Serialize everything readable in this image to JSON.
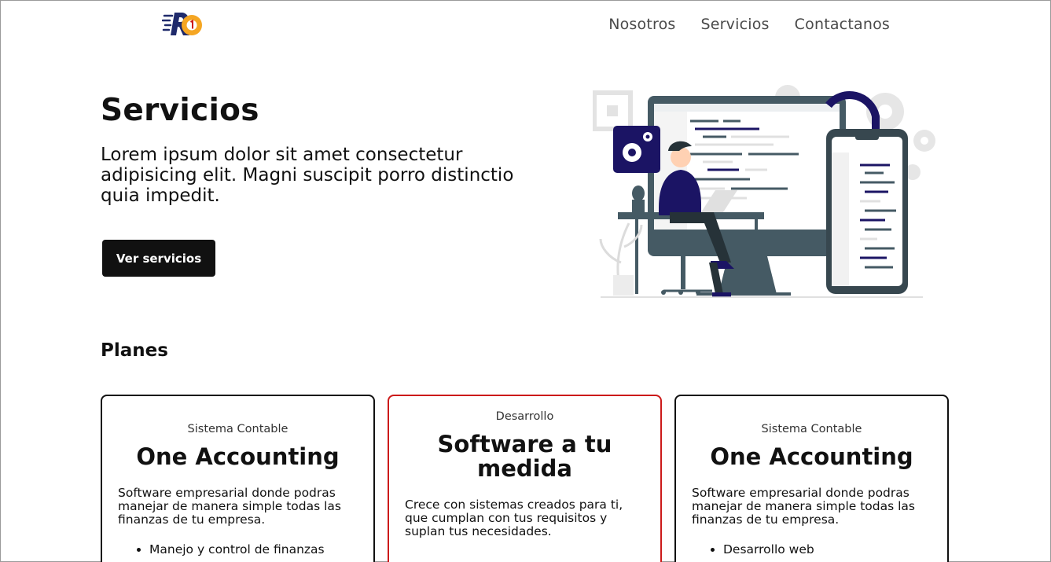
{
  "nav": {
    "items": [
      {
        "label": "Nosotros"
      },
      {
        "label": "Servicios"
      },
      {
        "label": "Contactanos"
      }
    ]
  },
  "hero": {
    "title": "Servicios",
    "text": "Lorem ipsum dolor sit amet consectetur adipisicing elit. Magni suscipit porro distinctio quia impedit.",
    "button_label": "Ver servicios"
  },
  "plans": {
    "title": "Planes",
    "cards": [
      {
        "category": "Sistema Contable",
        "title": "One Accounting",
        "description": "Software empresarial donde podras manejar de manera simple todas las finanzas de tu empresa.",
        "features": [
          "Manejo y control de finanzas"
        ]
      },
      {
        "category": "Desarrollo",
        "title": "Software a tu medida",
        "description": "Crece con sistemas creados para ti, que cumplan con tus requisitos y suplan tus necesidades.",
        "features": []
      },
      {
        "category": "Sistema Contable",
        "title": "One Accounting",
        "description": "Software empresarial donde podras manejar de manera simple todas las finanzas de tu empresa.",
        "features": [
          "Desarrollo web"
        ]
      }
    ]
  },
  "colors": {
    "primary": "#111111",
    "accent_border": "#cc1a1a",
    "logo_navy": "#1f2a6b",
    "logo_orange": "#f5a623",
    "illustration_navy": "#1b1464"
  }
}
